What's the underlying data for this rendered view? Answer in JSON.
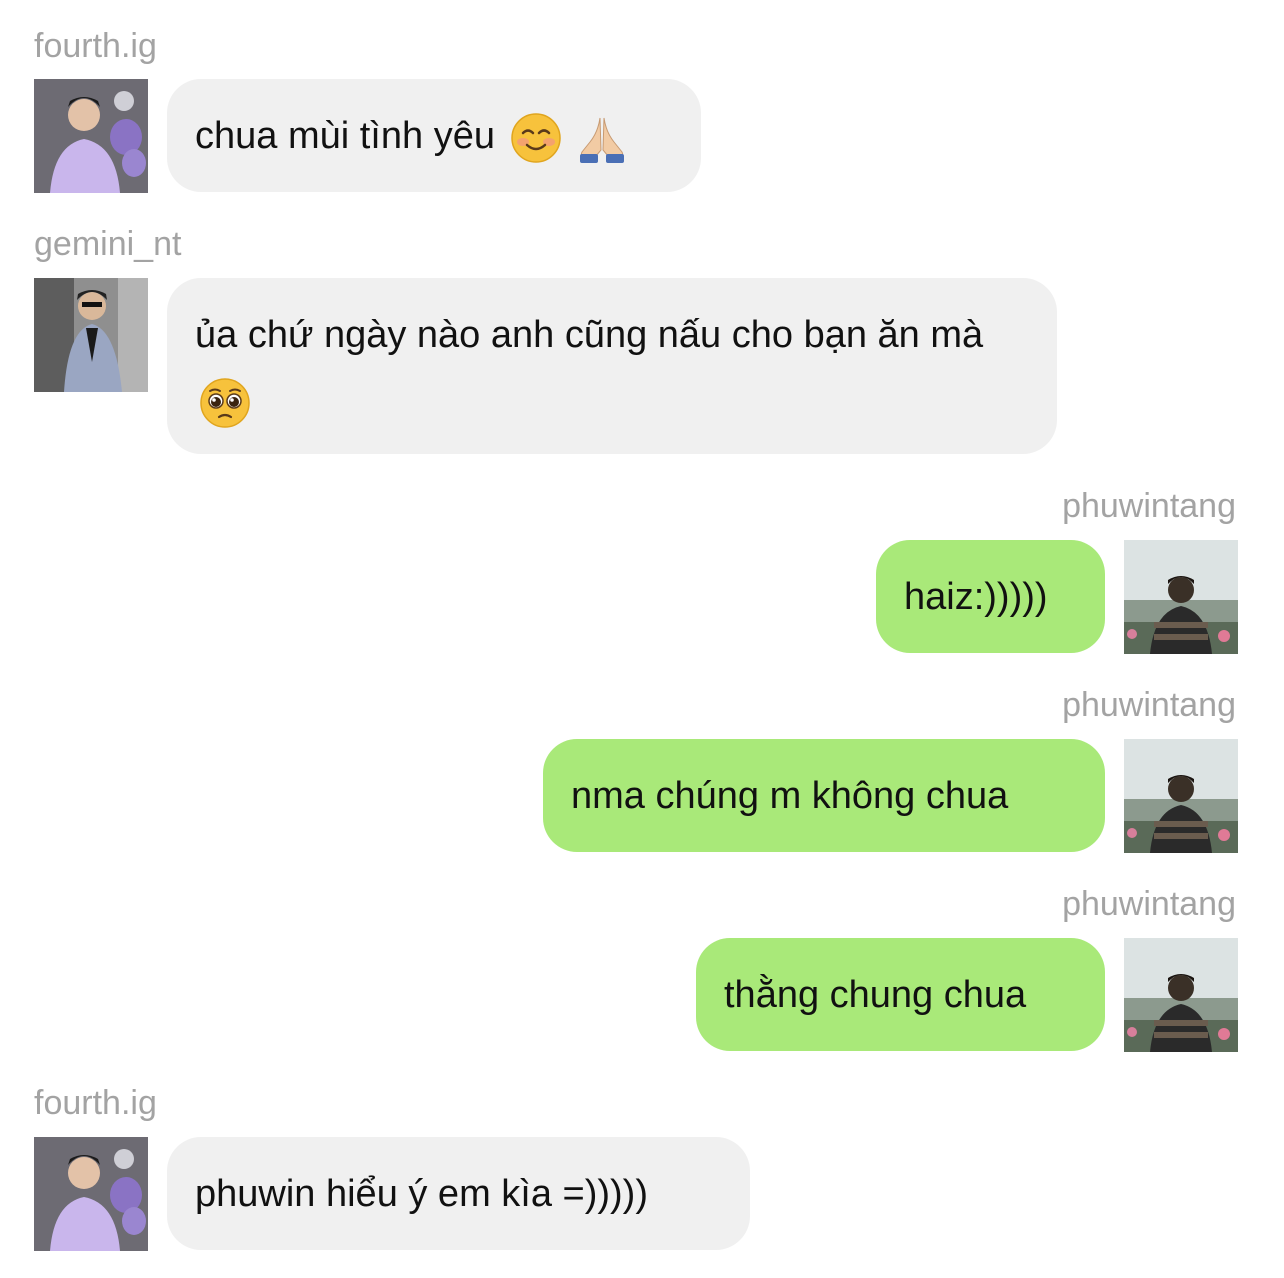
{
  "messages": [
    {
      "user": "fourth.ig",
      "text": "chua mùi tình yêu",
      "emoji": [
        "smiling-face-icon",
        "folded-hands-icon"
      ],
      "side": "left"
    },
    {
      "user": "gemini_nt",
      "text": "ủa chứ ngày nào anh cũng nấu cho bạn ăn mà",
      "emoji": [
        "pleading-face-icon"
      ],
      "side": "left"
    },
    {
      "user": "phuwintang",
      "text": "haiz:)))))",
      "side": "right"
    },
    {
      "user": "phuwintang",
      "text": "nma chúng m không chua",
      "side": "right"
    },
    {
      "user": "phuwintang",
      "text": "thằng chung chua",
      "side": "right"
    },
    {
      "user": "fourth.ig",
      "text": "phuwin hiểu ý em kìa =)))))",
      "side": "left"
    }
  ],
  "colors": {
    "incoming_bubble": "#f0f0f0",
    "outgoing_bubble": "#a9e979",
    "username_text": "#a3a3a3",
    "message_text": "#111111"
  }
}
